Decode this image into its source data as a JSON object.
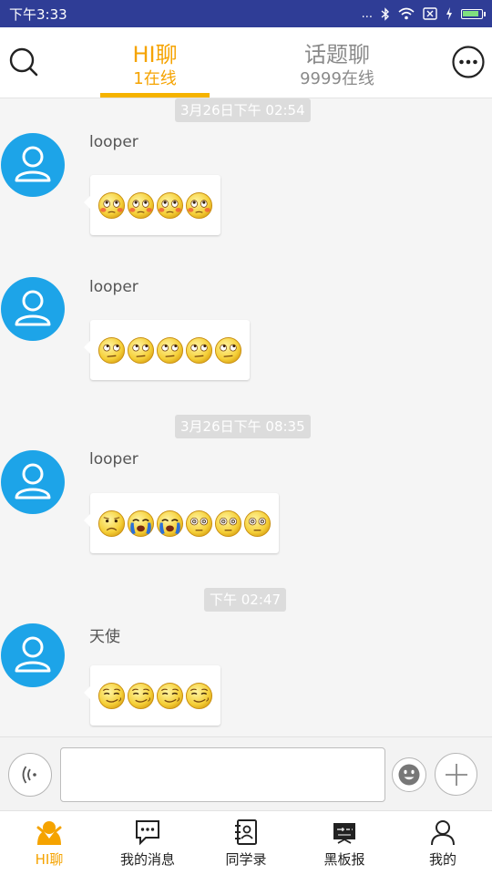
{
  "status_bar": {
    "time": "下午3:33",
    "dots": "...",
    "battery_fill": 0.9
  },
  "header": {
    "tabs": [
      {
        "title": "HI聊",
        "subtitle": "1在线",
        "active": true
      },
      {
        "title": "话题聊",
        "subtitle": "9999在线",
        "active": false
      }
    ],
    "left_icon": "search-icon",
    "right_icon": "more-icon"
  },
  "messages": {
    "time_chips": [
      "3月26日下午 02:54",
      "3月26日下午 08:35",
      "下午 02:47"
    ],
    "items": [
      {
        "sender": "looper",
        "emojis": [
          "flushed-face",
          "flushed-face",
          "flushed-face",
          "flushed-face"
        ]
      },
      {
        "sender": "looper",
        "emojis": [
          "rolling-eyes-face",
          "rolling-eyes-face",
          "rolling-eyes-face",
          "rolling-eyes-face",
          "rolling-eyes-face"
        ]
      },
      {
        "sender": "looper",
        "emojis": [
          "sad-face",
          "crying-face",
          "crying-face",
          "stunned-face",
          "stunned-face",
          "stunned-face"
        ]
      },
      {
        "sender": "天使",
        "emojis": [
          "smirk-face",
          "smirk-face",
          "smirk-face",
          "smirk-face"
        ]
      }
    ]
  },
  "input": {
    "value": "",
    "placeholder": ""
  },
  "bottom_nav": [
    {
      "label": "HI聊",
      "icon": "hi-chat-icon",
      "active": true
    },
    {
      "label": "我的消息",
      "icon": "message-icon",
      "active": false
    },
    {
      "label": "同学录",
      "icon": "classmates-icon",
      "active": false
    },
    {
      "label": "黑板报",
      "icon": "blackboard-icon",
      "active": false
    },
    {
      "label": "我的",
      "icon": "profile-icon",
      "active": false
    }
  ],
  "colors": {
    "status_bar": "#2f3d96",
    "accent": "#f5a300",
    "avatar": "#1da4e8",
    "chip": "#dcdcdc"
  }
}
